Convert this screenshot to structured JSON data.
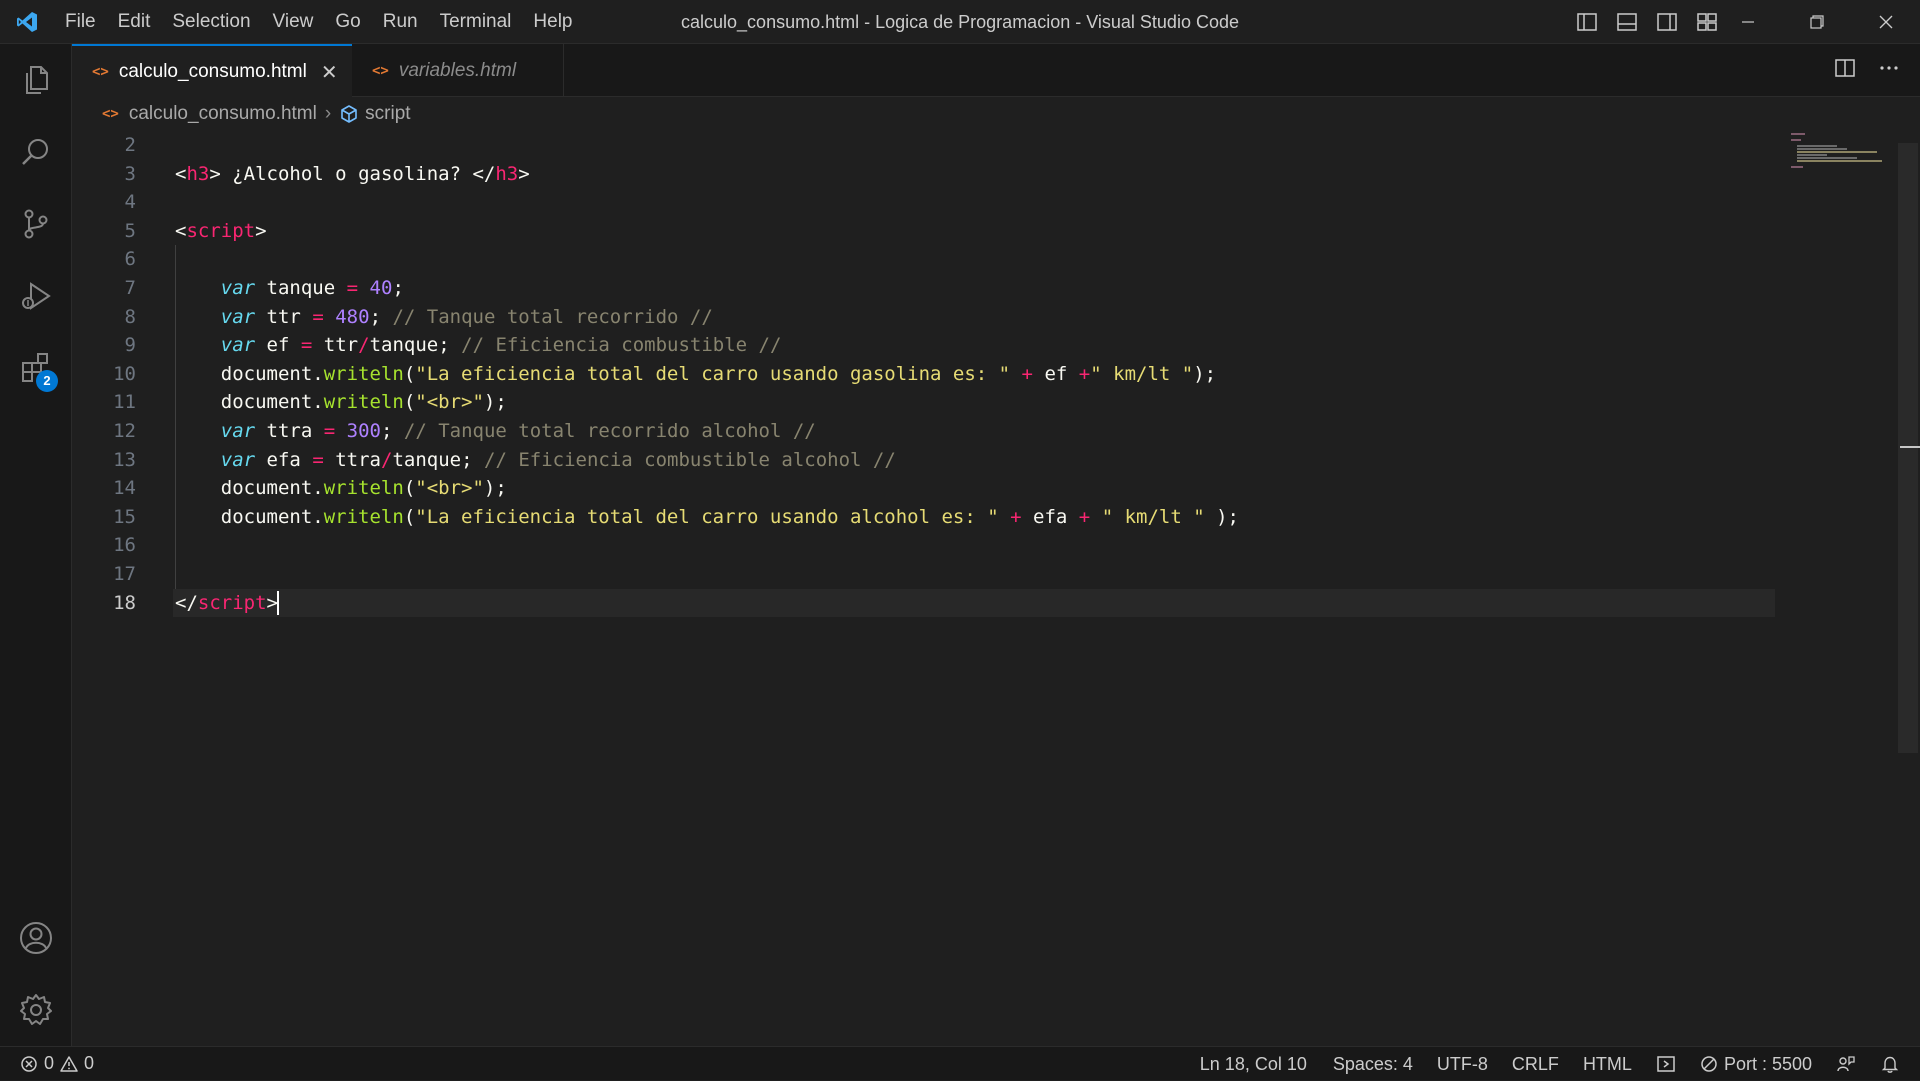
{
  "window": {
    "title": "calculo_consumo.html - Logica de Programacion - Visual Studio Code",
    "menu": [
      "File",
      "Edit",
      "Selection",
      "View",
      "Go",
      "Run",
      "Terminal",
      "Help"
    ]
  },
  "activity_bar": {
    "items": [
      {
        "icon": "files-icon",
        "label": "Explorer"
      },
      {
        "icon": "search-icon",
        "label": "Search"
      },
      {
        "icon": "source-control-icon",
        "label": "Source Control"
      },
      {
        "icon": "run-debug-icon",
        "label": "Run and Debug"
      },
      {
        "icon": "extensions-icon",
        "label": "Extensions",
        "badge": "2"
      }
    ],
    "bottom": [
      {
        "icon": "account-icon"
      },
      {
        "icon": "settings-gear-icon"
      }
    ]
  },
  "tabs": [
    {
      "label": "calculo_consumo.html",
      "active": true,
      "icon_glyph": "<>",
      "close": "✕"
    },
    {
      "label": "variables.html",
      "active": false,
      "icon_glyph": "<>"
    }
  ],
  "breadcrumbs": {
    "file": "calculo_consumo.html",
    "symbol": "script",
    "separator": "›"
  },
  "editor": {
    "current_line": 18,
    "lines": [
      {
        "n": "2"
      },
      {
        "n": "3"
      },
      {
        "n": "4"
      },
      {
        "n": "5"
      },
      {
        "n": "6"
      },
      {
        "n": "7"
      },
      {
        "n": "8"
      },
      {
        "n": "9"
      },
      {
        "n": "10"
      },
      {
        "n": "11"
      },
      {
        "n": "12"
      },
      {
        "n": "13"
      },
      {
        "n": "14"
      },
      {
        "n": "15"
      },
      {
        "n": "16"
      },
      {
        "n": "17"
      },
      {
        "n": "18"
      }
    ],
    "code": {
      "l3": {
        "open_tag": "h3",
        "text": " ¿Alcohol o gasolina? ",
        "close_tag": "h3"
      },
      "l5": {
        "tag": "script"
      },
      "l7": {
        "kw": "var",
        "name": "tanque",
        "op": "=",
        "num": "40"
      },
      "l8": {
        "kw": "var",
        "name": "ttr",
        "op": "=",
        "num": "480",
        "comment": "// Tanque total recorrido //"
      },
      "l9": {
        "kw": "var",
        "name": "ef",
        "op": "=",
        "a": "ttr",
        "div": "/",
        "b": "tanque",
        "comment": "// Eficiencia combustible //"
      },
      "l10": {
        "obj": "document",
        "fn": "writeln",
        "str1": "\"La eficiencia total del carro usando gasolina es: \"",
        "plus": "+",
        "v": "ef",
        "str2": "\" km/lt \""
      },
      "l11": {
        "obj": "document",
        "fn": "writeln",
        "str": "\"<br>\""
      },
      "l12": {
        "kw": "var",
        "name": "ttra",
        "op": "=",
        "num": "300",
        "comment": "// Tanque total recorrido alcohol //"
      },
      "l13": {
        "kw": "var",
        "name": "efa",
        "op": "=",
        "a": "ttra",
        "div": "/",
        "b": "tanque",
        "comment": "// Eficiencia combustible alcohol //"
      },
      "l14": {
        "obj": "document",
        "fn": "writeln",
        "str": "\"<br>\""
      },
      "l15": {
        "obj": "document",
        "fn": "writeln",
        "str1": "\"La eficiencia total del carro usando alcohol es: \"",
        "plus": "+",
        "v": "efa",
        "str2": "\" km/lt \""
      },
      "l18": {
        "tag": "script"
      }
    }
  },
  "status_bar": {
    "errors": "0",
    "warnings": "0",
    "position": "Ln 18, Col 10",
    "spaces": "Spaces: 4",
    "encoding": "UTF-8",
    "eol": "CRLF",
    "language": "HTML",
    "port": "Port : 5500"
  },
  "colors": {
    "accent": "#0078d4",
    "editor_bg": "#1f1f1f",
    "html_icon": "#e37933"
  }
}
